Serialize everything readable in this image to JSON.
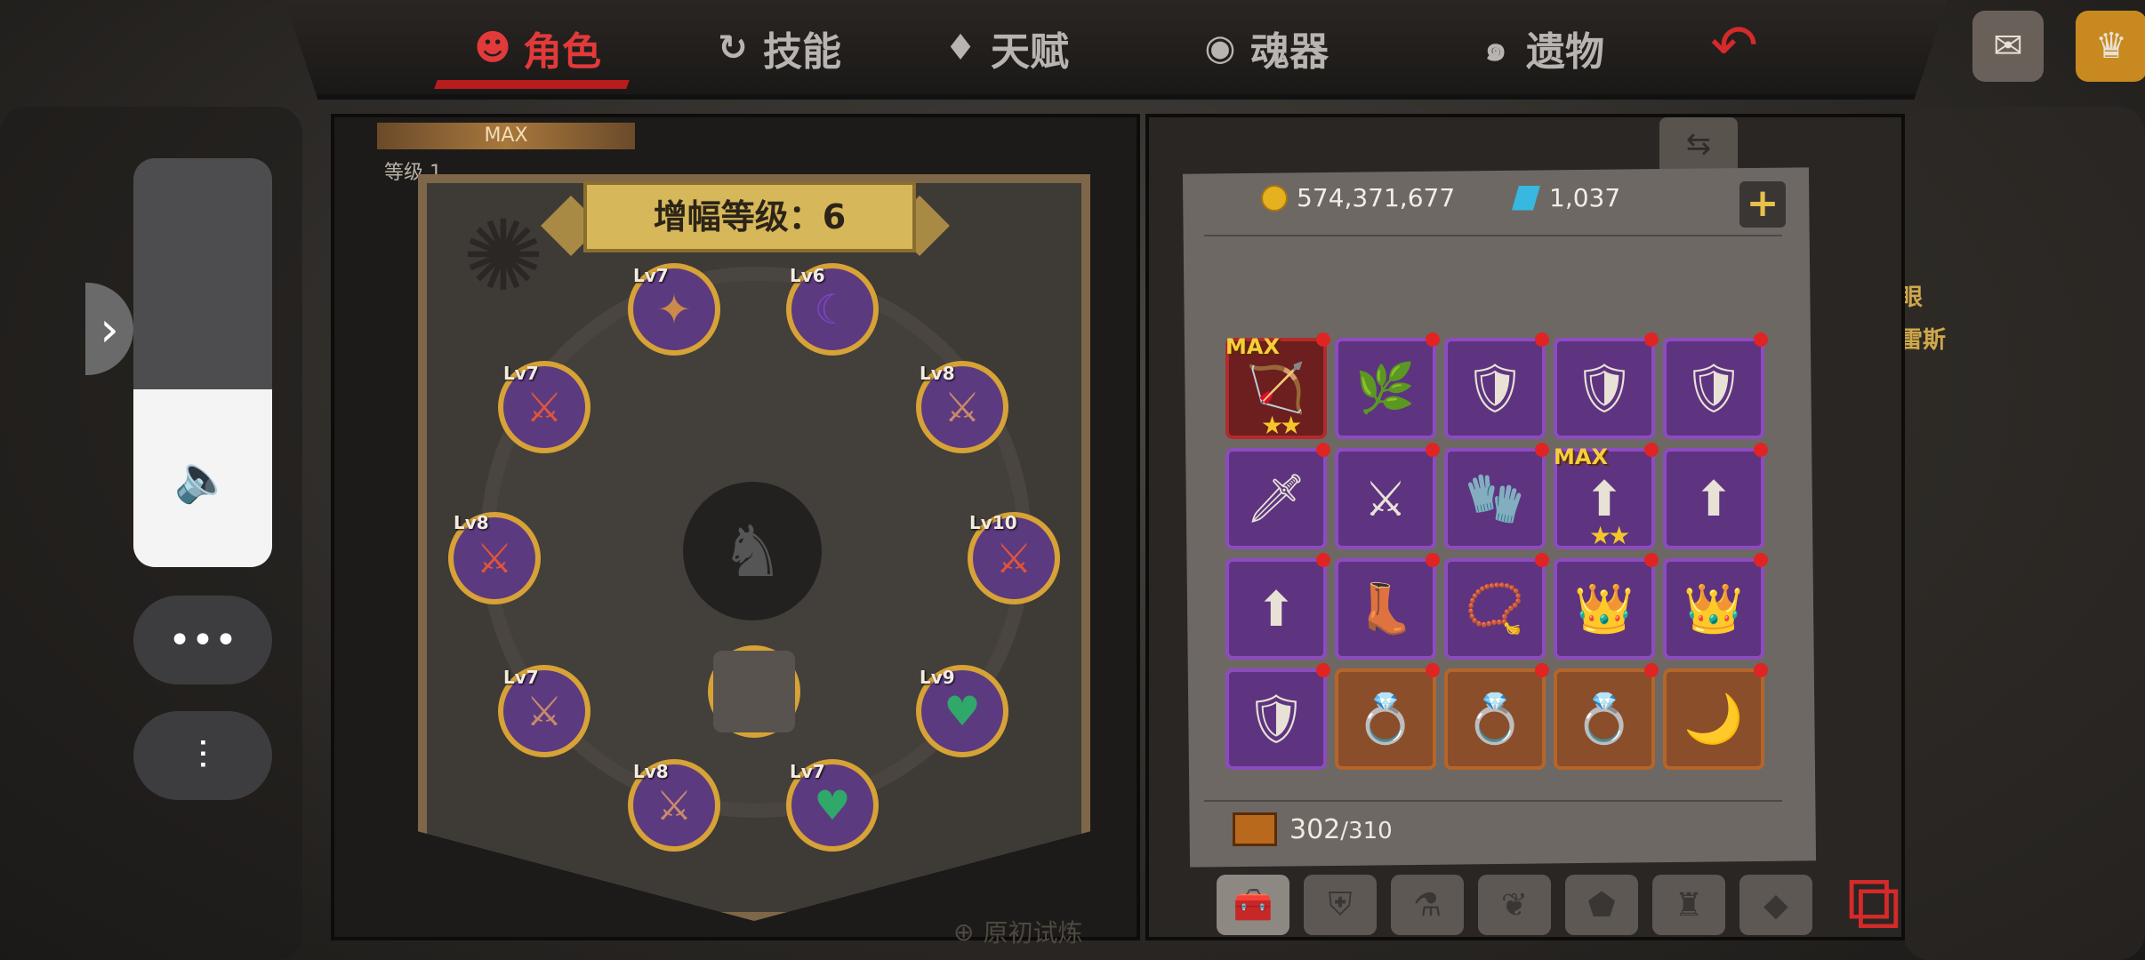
{
  "tabs": [
    {
      "label": "角色",
      "icon": "character-icon",
      "active": true
    },
    {
      "label": "技能",
      "icon": "skill-icon",
      "active": false
    },
    {
      "label": "天赋",
      "icon": "talent-icon",
      "active": false
    },
    {
      "label": "魂器",
      "icon": "soul-vessel-icon",
      "active": false
    },
    {
      "label": "遗物",
      "icon": "relic-icon",
      "active": false
    }
  ],
  "char_header": {
    "max_label": "MAX",
    "level_label": "等级 1"
  },
  "amplify": {
    "title": "增幅等级：6",
    "slots": [
      {
        "lv": "Lv7",
        "color": "#c98a4a",
        "glyph": "✦"
      },
      {
        "lv": "Lv6",
        "color": "#7a44c0",
        "glyph": "☾"
      },
      {
        "lv": "Lv7",
        "color": "#e0553a",
        "glyph": "⚔"
      },
      {
        "lv": "Lv8",
        "color": "#c98a6a",
        "glyph": "⚔"
      },
      {
        "lv": "Lv8",
        "color": "#e0553a",
        "glyph": "⚔"
      },
      {
        "lv": "Lv10",
        "color": "#e0553a",
        "glyph": "⚔"
      },
      {
        "lv": "Lv7",
        "color": "#c98a6a",
        "glyph": "⚔"
      },
      {
        "lv": "",
        "color": "#58534e",
        "glyph": ""
      },
      {
        "lv": "Lv9",
        "color": "#2fa86a",
        "glyph": "♥"
      },
      {
        "lv": "Lv8",
        "color": "#c98a6a",
        "glyph": "⚔"
      },
      {
        "lv": "Lv7",
        "color": "#2fa86a",
        "glyph": "♥"
      }
    ]
  },
  "currency": {
    "gold": "574,371,677",
    "gems": "1,037"
  },
  "inventory": {
    "capacity_used": "302",
    "capacity_total": "/310",
    "items": [
      {
        "icon": "🏹",
        "rarity": "red",
        "max": true,
        "stars": "★★"
      },
      {
        "icon": "🌿",
        "rarity": "purple"
      },
      {
        "icon": "🛡",
        "rarity": "purple"
      },
      {
        "icon": "🛡",
        "rarity": "purple"
      },
      {
        "icon": "🛡",
        "rarity": "purple"
      },
      {
        "icon": "🗡",
        "rarity": "purple"
      },
      {
        "icon": "⚔",
        "rarity": "purple"
      },
      {
        "icon": "🧤",
        "rarity": "purple"
      },
      {
        "icon": "⬆",
        "rarity": "purple",
        "max": true,
        "stars": "★★"
      },
      {
        "icon": "⬆",
        "rarity": "purple"
      },
      {
        "icon": "⬆",
        "rarity": "purple"
      },
      {
        "icon": "👢",
        "rarity": "purple"
      },
      {
        "icon": "📿",
        "rarity": "purple"
      },
      {
        "icon": "👑",
        "rarity": "purple"
      },
      {
        "icon": "👑",
        "rarity": "purple"
      },
      {
        "icon": "🛡",
        "rarity": "purple"
      },
      {
        "icon": "💍",
        "rarity": "orange"
      },
      {
        "icon": "💍",
        "rarity": "orange"
      },
      {
        "icon": "💍",
        "rarity": "orange"
      },
      {
        "icon": "🌙",
        "rarity": "orange"
      }
    ],
    "max_label": "MAX"
  },
  "category_tabs": [
    "toolbox-icon",
    "armor-icon",
    "potion-icon",
    "leaf-icon",
    "rune-icon",
    "helmet-icon",
    "gem-icon"
  ],
  "footer_link": "原初试炼",
  "npc_texts": [
    "眼",
    "雷斯"
  ]
}
